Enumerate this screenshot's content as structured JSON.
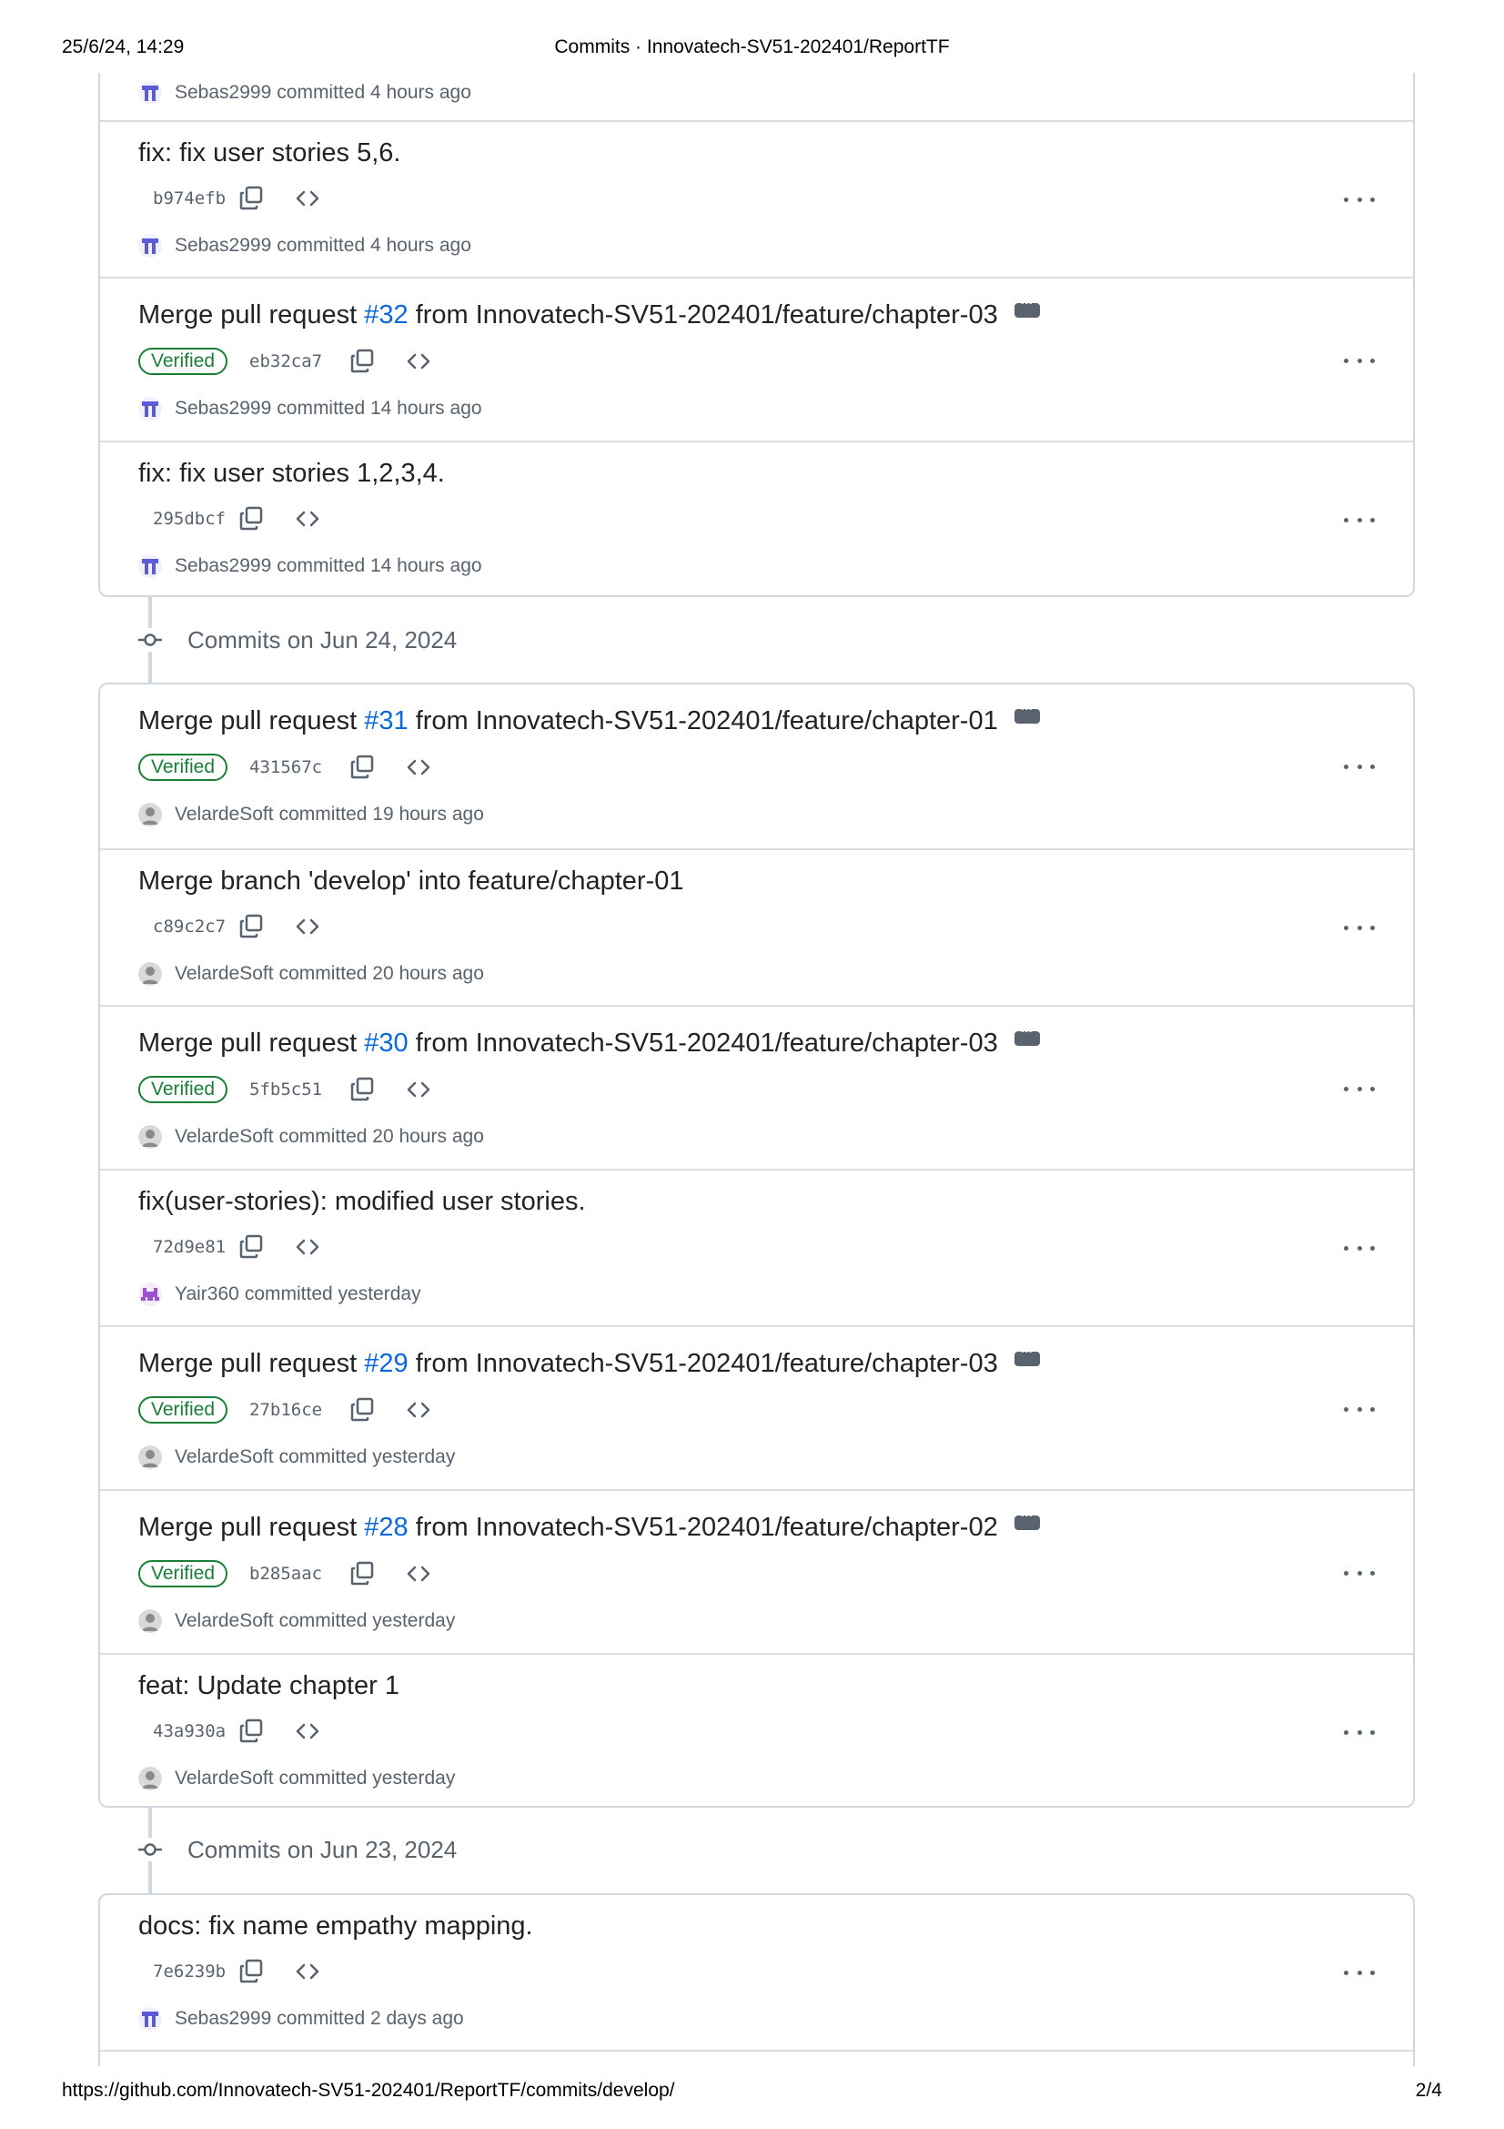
{
  "print": {
    "datetime": "25/6/24, 14:29",
    "page_title": "Commits · Innovatech-SV51-202401/ReportTF",
    "url": "https://github.com/Innovatech-SV51-202401/ReportTF/commits/develop/",
    "page_number": "2/4"
  },
  "groups": [
    {
      "date_label": "",
      "commits": [
        {
          "title_text": "",
          "has_pr": false,
          "verified": false,
          "sha": "",
          "author": "Sebas2999",
          "time": "committed 4 hours ago",
          "avatar": "sebas",
          "partial": true
        },
        {
          "title_text": "fix: fix user stories 5,6.",
          "has_pr": false,
          "verified": false,
          "sha": "b974efb",
          "author": "Sebas2999",
          "time": "committed 4 hours ago",
          "avatar": "sebas"
        },
        {
          "title_prefix": "Merge pull request ",
          "pr": "#32",
          "title_suffix": " from Innovatech-SV51-202401/feature/chapter-03",
          "has_pr": true,
          "verified": true,
          "sha": "eb32ca7",
          "author": "Sebas2999",
          "time": "committed 14 hours ago",
          "avatar": "sebas"
        },
        {
          "title_text": "fix: fix user stories 1,2,3,4.",
          "has_pr": false,
          "verified": false,
          "sha": "295dbcf",
          "author": "Sebas2999",
          "time": "committed 14 hours ago",
          "avatar": "sebas"
        }
      ]
    },
    {
      "date_label": "Commits on Jun 24, 2024",
      "commits": [
        {
          "title_prefix": "Merge pull request ",
          "pr": "#31",
          "title_suffix": " from Innovatech-SV51-202401/feature/chapter-01",
          "has_pr": true,
          "verified": true,
          "sha": "431567c",
          "author": "VelardeSoft",
          "time": "committed 19 hours ago",
          "avatar": "velarde"
        },
        {
          "title_text": "Merge branch 'develop' into feature/chapter-01",
          "has_pr": false,
          "verified": false,
          "sha": "c89c2c7",
          "author": "VelardeSoft",
          "time": "committed 20 hours ago",
          "avatar": "velarde"
        },
        {
          "title_prefix": "Merge pull request ",
          "pr": "#30",
          "title_suffix": " from Innovatech-SV51-202401/feature/chapter-03",
          "has_pr": true,
          "verified": true,
          "sha": "5fb5c51",
          "author": "VelardeSoft",
          "time": "committed 20 hours ago",
          "avatar": "velarde"
        },
        {
          "title_text": "fix(user-stories): modified user stories.",
          "has_pr": false,
          "verified": false,
          "sha": "72d9e81",
          "author": "Yair360",
          "time": "committed yesterday",
          "avatar": "yair"
        },
        {
          "title_prefix": "Merge pull request ",
          "pr": "#29",
          "title_suffix": " from Innovatech-SV51-202401/feature/chapter-03",
          "has_pr": true,
          "verified": true,
          "sha": "27b16ce",
          "author": "VelardeSoft",
          "time": "committed yesterday",
          "avatar": "velarde"
        },
        {
          "title_prefix": "Merge pull request ",
          "pr": "#28",
          "title_suffix": " from Innovatech-SV51-202401/feature/chapter-02",
          "has_pr": true,
          "verified": true,
          "sha": "b285aac",
          "author": "VelardeSoft",
          "time": "committed yesterday",
          "avatar": "velarde"
        },
        {
          "title_text": "feat: Update chapter 1",
          "has_pr": false,
          "verified": false,
          "sha": "43a930a",
          "author": "VelardeSoft",
          "time": "committed yesterday",
          "avatar": "velarde"
        }
      ]
    },
    {
      "date_label": "Commits on Jun 23, 2024",
      "commits": [
        {
          "title_text": "docs: fix name empathy mapping.",
          "has_pr": false,
          "verified": false,
          "sha": "7e6239b",
          "author": "Sebas2999",
          "time": "committed 2 days ago",
          "avatar": "sebas"
        }
      ]
    }
  ],
  "labels": {
    "verified": "Verified"
  },
  "colors": {
    "link": "#0969da",
    "verified": "#1a7f37",
    "muted": "#59636e",
    "border": "#d0d7de"
  }
}
